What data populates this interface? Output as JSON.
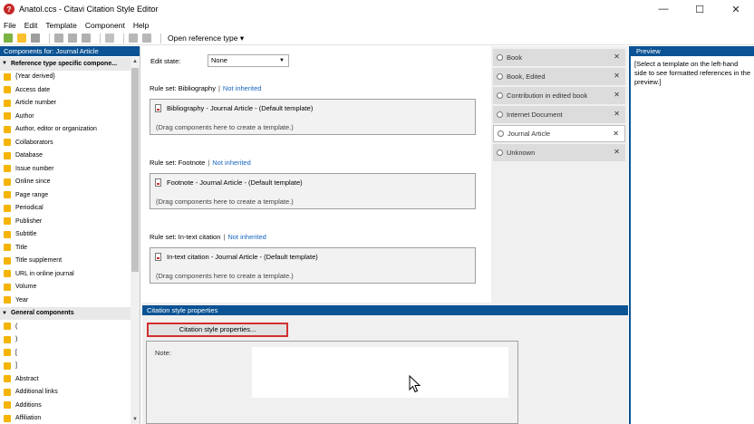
{
  "window": {
    "title": "Anatol.ccs - Citavi Citation Style Editor",
    "controls": {
      "minimize": "—",
      "maximize": "☐",
      "close": "✕"
    }
  },
  "menu": [
    "File",
    "Edit",
    "Template",
    "Component",
    "Help"
  ],
  "toolbar": {
    "icons": [
      "new-icon",
      "open-icon",
      "save-icon",
      "cut-icon",
      "copy-icon",
      "paste-icon",
      "delete-icon",
      "undo-icon",
      "redo-icon"
    ],
    "open_reference_type": "Open reference type",
    "dropdown_arrow": "▾"
  },
  "components_panel": {
    "header": "Components for: Journal Article",
    "groups": [
      {
        "label": "Reference type specific compone...",
        "items": [
          "{Year derived}",
          "Access date",
          "Article number",
          "Author",
          "Author, editor or organization",
          "Collaborators",
          "Database",
          "Issue number",
          "Online since",
          "Page range",
          "Periodical",
          "Publisher",
          "Subtitle",
          "Title",
          "Title supplement",
          "URL in online journal",
          "Volume",
          "Year"
        ]
      },
      {
        "label": "General components",
        "items": [
          "(",
          ")",
          "[",
          "]",
          "Abstract",
          "Additional links",
          "Additions",
          "Affiliation"
        ]
      }
    ]
  },
  "editor": {
    "edit_state_label": "Edit state:",
    "edit_state_value": "None",
    "rulesets": [
      {
        "label": "Rule set: Bibliography",
        "sep": "|",
        "link": "Not inherited",
        "template": "Bibliography - Journal Article - (Default template)",
        "hint": "(Drag components here to create a template.)"
      },
      {
        "label": "Rule set: Footnote",
        "sep": "|",
        "link": "Not inherited",
        "template": "Footnote - Journal Article - (Default template)",
        "hint": "(Drag components here to create a template.)"
      },
      {
        "label": "Rule set: In-text citation",
        "sep": "|",
        "link": "Not inherited",
        "template": "In-text citation - Journal Article - (Default template)",
        "hint": "(Drag components here to create a template.)"
      }
    ]
  },
  "reference_types": [
    {
      "label": "Book",
      "active": false
    },
    {
      "label": "Book, Edited",
      "active": false
    },
    {
      "label": "Contribution in edited book",
      "active": false
    },
    {
      "label": "Internet Document",
      "active": false
    },
    {
      "label": "Journal Article",
      "active": true
    },
    {
      "label": "Unknown",
      "active": false
    }
  ],
  "properties": {
    "header": "Citation style properties",
    "button": "Citation style properties...",
    "note_label": "Note:"
  },
  "preview": {
    "header": "Preview",
    "text": "[Select a template on the left-hand side to see formatted references in the preview.]"
  },
  "colors": {
    "header_blue": "#0b5394",
    "link_blue": "#1565c0",
    "highlight_red": "#d32f2f",
    "folder_yellow": "#f4b400"
  }
}
